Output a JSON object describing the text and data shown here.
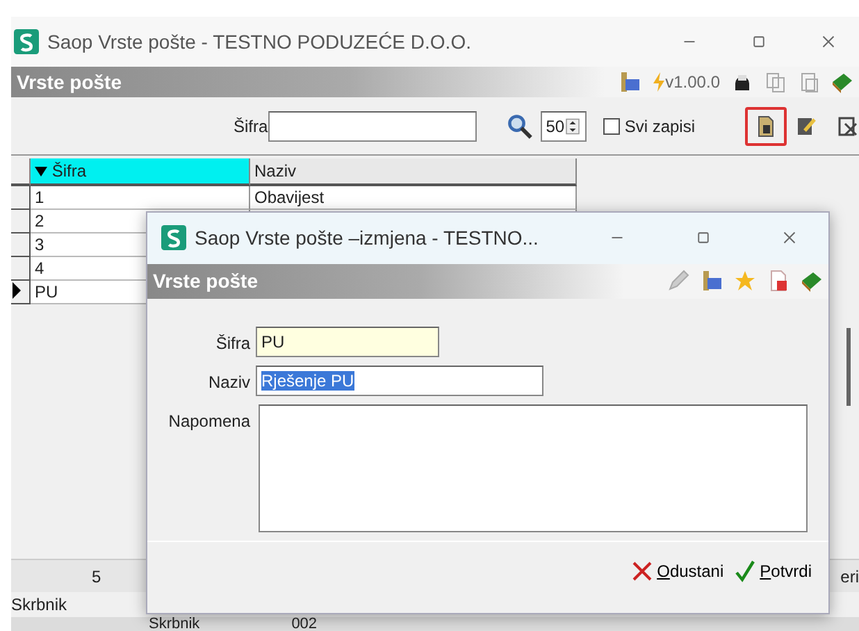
{
  "window": {
    "title": "Saop Vrste pošte  - TESTNO PODUZEĆE D.O.O."
  },
  "header": {
    "title": "Vrste pošte",
    "version": "v1.00.0"
  },
  "toolbar": {
    "filter_label": "Šifra",
    "page_size": "50",
    "all_records": {
      "label": "Svi zapisi",
      "checked": false
    }
  },
  "grid": {
    "columns": [
      "Šifra",
      "Naziv"
    ],
    "rows": [
      {
        "code": "1",
        "name": "Obavijest",
        "current": false
      },
      {
        "code": "2",
        "current": false
      },
      {
        "code": "3",
        "current": false
      },
      {
        "code": "4",
        "current": false
      },
      {
        "code": "PU",
        "current": true
      }
    ],
    "count": "5",
    "column_3": "eri"
  },
  "status": {
    "label": "Skrbnik"
  },
  "bottom_row": [
    "Skrbnik",
    "002"
  ],
  "dialog": {
    "title": "Saop Vrste pošte –izmjena  - TESTNO...",
    "header": "Vrste pošte",
    "fields": [
      {
        "label": "Šifra",
        "value": "PU",
        "kind": "code",
        "selected": false
      },
      {
        "label": "Naziv",
        "value": "Rješenje PU",
        "kind": "text",
        "selected": true
      },
      {
        "label": "Napomena",
        "kind": "memo"
      }
    ],
    "buttons": [
      {
        "label": "Odustani",
        "kind": "cancel"
      },
      {
        "label": "Potvrdi",
        "kind": "ok"
      }
    ]
  }
}
